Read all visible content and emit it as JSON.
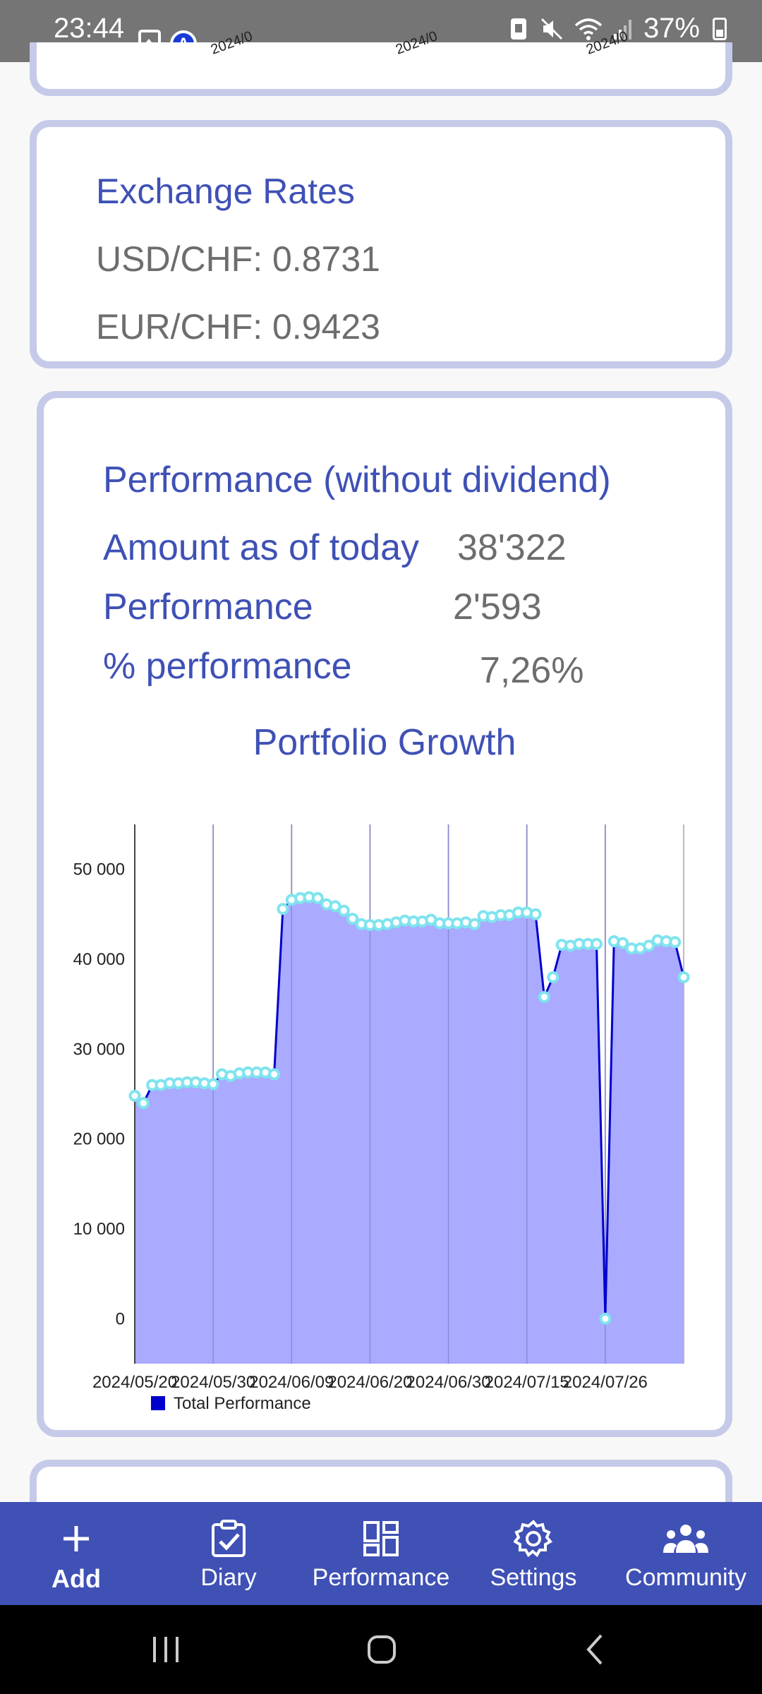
{
  "status_bar": {
    "time": "23:44",
    "battery": "37%"
  },
  "prev_card": {
    "ticks": [
      "2024/0",
      "2024/0",
      "2024/0"
    ]
  },
  "exchange_rates": {
    "title": "Exchange Rates",
    "usd_chf": "USD/CHF: 0.8731",
    "eur_chf": "EUR/CHF: 0.9423"
  },
  "performance": {
    "title": "Performance (without dividend)",
    "amount_label": "Amount as of today",
    "amount_value": "38'322",
    "performance_label": "Performance",
    "performance_value": "2'593",
    "pct_label": "% performance",
    "pct_value": "7,26%"
  },
  "chart_data": {
    "type": "area",
    "title": "Portfolio Growth",
    "ylim": [
      -5000,
      55000
    ],
    "yticks": [
      0,
      10000,
      20000,
      30000,
      40000,
      50000
    ],
    "ytick_labels": [
      "0",
      "10 000",
      "20 000",
      "30 000",
      "40 000",
      "50 000"
    ],
    "xtick_labels": [
      "2024/05/20",
      "2024/05/30",
      "2024/06/09",
      "2024/06/20",
      "2024/06/30",
      "2024/07/15",
      "2024/07/26"
    ],
    "legend": "Total Performance",
    "legend_position": "bottom-left",
    "colors": {
      "line": "#0000cc",
      "fill": "#aaaaff",
      "marker": "#7fe4ee"
    },
    "series": [
      {
        "name": "Total Performance",
        "values": [
          24800,
          24000,
          26000,
          26000,
          26200,
          26200,
          26300,
          26300,
          26200,
          26100,
          27200,
          27000,
          27300,
          27400,
          27400,
          27400,
          27200,
          45600,
          46600,
          46800,
          46900,
          46800,
          46100,
          45900,
          45400,
          44500,
          43900,
          43800,
          43800,
          43900,
          44100,
          44300,
          44200,
          44200,
          44400,
          44000,
          44000,
          44000,
          44100,
          43900,
          44800,
          44700,
          44900,
          44900,
          45200,
          45200,
          45000,
          35800,
          38000,
          41600,
          41500,
          41700,
          41700,
          41700,
          0,
          42000,
          41800,
          41200,
          41200,
          41500,
          42100,
          42000,
          41900,
          38000
        ]
      }
    ]
  },
  "bottom_nav": {
    "items": [
      {
        "label": "Add",
        "icon": "plus-icon"
      },
      {
        "label": "Diary",
        "icon": "clipboard-check-icon"
      },
      {
        "label": "Performance",
        "icon": "dashboard-icon"
      },
      {
        "label": "Settings",
        "icon": "gear-icon"
      },
      {
        "label": "Community",
        "icon": "people-icon"
      }
    ]
  }
}
